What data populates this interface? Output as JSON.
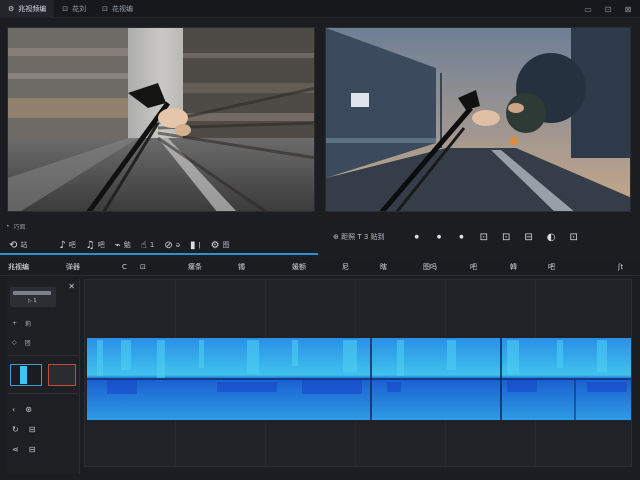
{
  "tabs": [
    {
      "label": "兆视频编"
    },
    {
      "label": "花刘"
    },
    {
      "label": "花视编"
    }
  ],
  "window_controls": [
    "minimize-icon",
    "restore-icon",
    "close-icon"
  ],
  "left_preview": {
    "meta_label": "巧面",
    "tools": [
      {
        "icon": "⟲",
        "label": "站"
      },
      {
        "icon": "♪",
        "label": "吧"
      },
      {
        "icon": "♫",
        "label": "吧"
      },
      {
        "icon": "⌁",
        "label": "勉"
      },
      {
        "icon": "☝",
        "label": "1"
      },
      {
        "icon": "⊘",
        "label": "ǝ"
      },
      {
        "icon": "▮",
        "label": "ǀ"
      },
      {
        "icon": "⚙",
        "label": "图"
      }
    ]
  },
  "right_preview": {
    "label": "⊕ 距照 T 3 贴到",
    "tools": [
      "●",
      "●",
      "●",
      "⊡",
      "⊡",
      "⊟",
      "◐",
      "⊡"
    ]
  },
  "modes": [
    {
      "label": "兆视编",
      "active": true
    },
    {
      "label": "弹器"
    },
    {
      "label": "C"
    },
    {
      "label": "⊡"
    },
    {
      "label": "瘰条"
    },
    {
      "label": "镯"
    },
    {
      "label": "媛额"
    },
    {
      "label": "尼"
    },
    {
      "label": "瞎"
    },
    {
      "label": "图吗"
    },
    {
      "label": "吧"
    },
    {
      "label": "韓"
    },
    {
      "label": "吧"
    },
    {
      "label": "ʃt"
    }
  ],
  "sidebar": {
    "card_label": "▷ 1",
    "items": [
      {
        "icon": "+",
        "label": "莉"
      },
      {
        "icon": "◇",
        "label": "团"
      }
    ],
    "tools": [
      {
        "icon": "‹",
        "label": "⊛"
      },
      {
        "icon": "↻",
        "label": "⊟"
      },
      {
        "icon": "⋖",
        "label": "⊟"
      }
    ]
  },
  "colors": {
    "accent": "#2d8fd3",
    "waveform_dark": "#1e6fd9",
    "waveform_light": "#3fc2ee",
    "clip_selected": "#36c8f0",
    "clip_marked": "#c24a3a"
  }
}
